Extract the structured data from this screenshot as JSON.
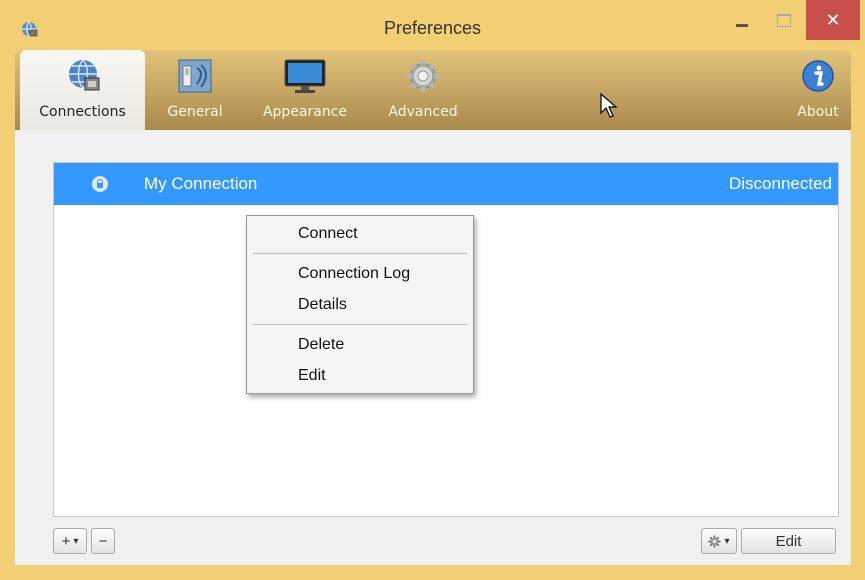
{
  "window": {
    "title": "Preferences",
    "min_label": "–",
    "close_label": "✕",
    "app_icon": "network-globe-icon"
  },
  "toolbar": {
    "tabs": [
      {
        "label": "Connections",
        "icon": "globe-network-icon",
        "active": true
      },
      {
        "label": "General",
        "icon": "switch-icon",
        "active": false
      },
      {
        "label": "Appearance",
        "icon": "monitor-icon",
        "active": false
      },
      {
        "label": "Advanced",
        "icon": "gear-icon",
        "active": false
      },
      {
        "label": "About",
        "icon": "info-icon",
        "active": false
      }
    ]
  },
  "connections": {
    "items": [
      {
        "name": "My Connection",
        "status": "Disconnected",
        "selected": true,
        "icon": "lock-icon"
      }
    ]
  },
  "context_menu": {
    "items": [
      "Connect",
      "Connection Log",
      "Details",
      "Delete",
      "Edit"
    ]
  },
  "bottom_bar": {
    "add_label": "+",
    "add_dropdown": "▾",
    "remove_label": "−",
    "gear_dropdown": "▾",
    "edit_label": "Edit"
  },
  "colors": {
    "window_frame": "#f3cf73",
    "close_button": "#c7504b",
    "selection": "#3399ff"
  }
}
